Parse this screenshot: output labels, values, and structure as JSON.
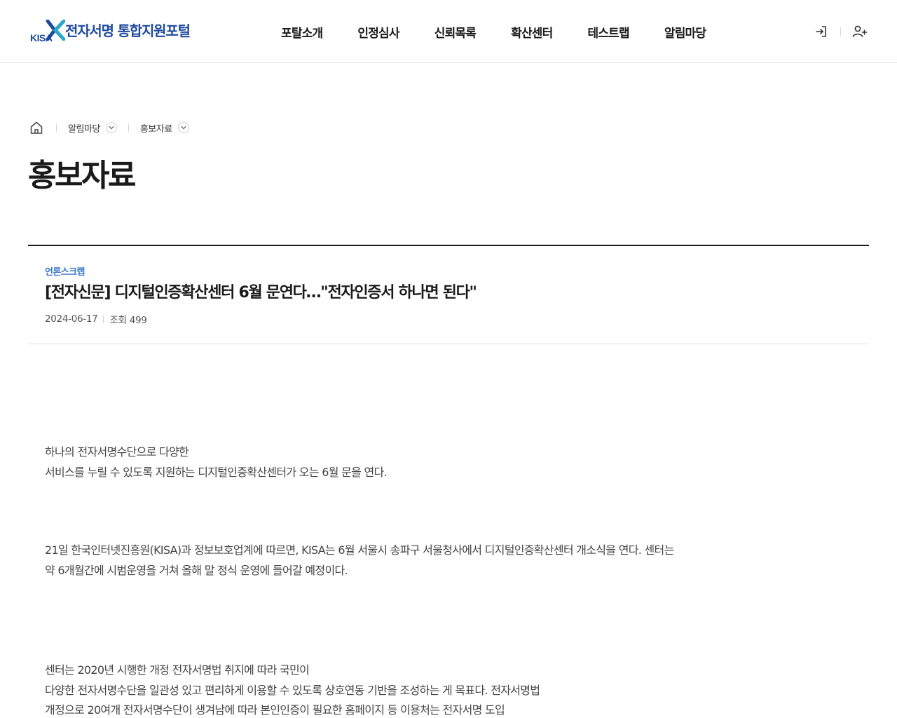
{
  "header": {
    "logo": {
      "mark_text": "KISA",
      "site_name": "전자서명 통합지원포털"
    },
    "nav": [
      {
        "label": "포탈소개"
      },
      {
        "label": "인정심사"
      },
      {
        "label": "신뢰목록"
      },
      {
        "label": "확산센터"
      },
      {
        "label": "테스트랩"
      },
      {
        "label": "알림마당"
      }
    ],
    "utility": {
      "login_icon": "login-icon",
      "signup_icon": "user-add-icon"
    }
  },
  "breadcrumb": {
    "home_icon": "home-icon",
    "items": [
      {
        "label": "알림마당"
      },
      {
        "label": "홍보자료"
      }
    ]
  },
  "page": {
    "title": "홍보자료"
  },
  "article": {
    "category": "언론스크랩",
    "title": "[전자신문] 디지털인증확산센터 6월 문연다…\"전자인증서 하나면 된다\"",
    "date": "2024-06-17",
    "views": "조회 499",
    "paragraphs": [
      {
        "lines": [
          "하나의 전자서명수단으로 다양한",
          "서비스를 누릴 수 있도록 지원하는 디지털인증확산센터가 오는 6월 문을 연다."
        ]
      },
      {
        "lines": [
          "21일 한국인터넷진흥원(KISA)과 정보보호업계에 따르면, KISA는 6월 서울시 송파구 서울청사에서 디지털인증확산센터 개소식을 연다. 센터는",
          "약 6개월간에 시범운영을 거쳐 올해 말 정식 운영에 들어갈 예정이다."
        ]
      },
      {
        "lines": [
          "센터는 2020년 시행한 개정 전자서명법 취지에 따라 국민이",
          "다양한 전자서명수단을 일관성 있고 편리하게 이용할 수 있도록 상호연동 기반을 조성하는 게 목표다. 전자서명법",
          "개정으로 20여개 전자서명수단이 생겨남에 따라 본인인증이 필요한 홈페이지 등 이용처는 전자서명 도입"
        ]
      }
    ]
  },
  "colors": {
    "brand_blue": "#1e4a9e",
    "category_blue": "#3a78c9",
    "text_dark": "#1a1a1a",
    "text_body": "#444444"
  }
}
